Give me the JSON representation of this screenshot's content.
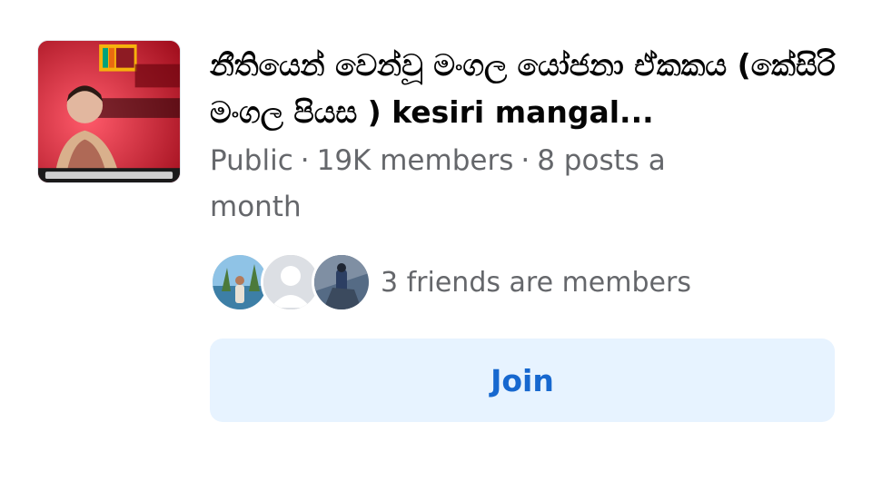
{
  "group": {
    "name": "නීතියෙන් වෙන්වූ මංගල යෝජනා ඒකකය (කේසිරි මංගල පියස ) kesiri mangal...",
    "privacy": "Public",
    "members": "19K members",
    "activity": "8 posts a month",
    "separator": "·"
  },
  "friends": {
    "text": "3 friends are members"
  },
  "join_button": {
    "label": "Join"
  },
  "colors": {
    "title": "#050505",
    "meta": "#65676b",
    "button_bg": "#e7f3ff",
    "button_text": "#1768cf"
  }
}
